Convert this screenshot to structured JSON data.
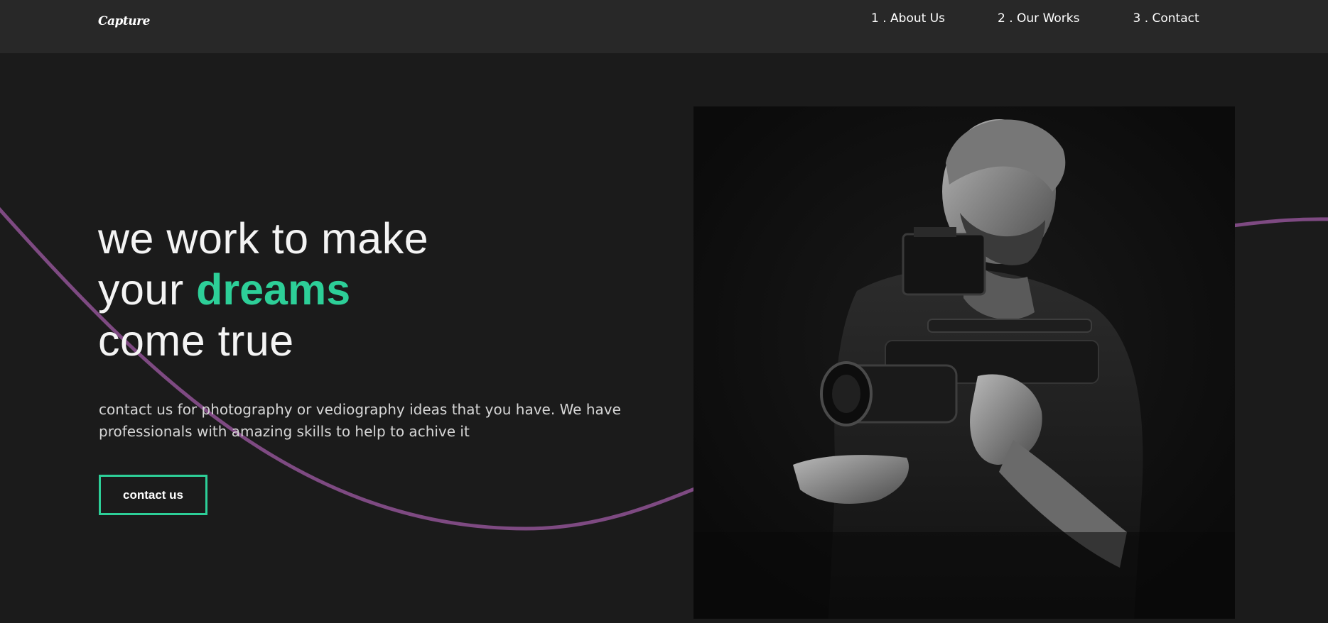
{
  "header": {
    "logo": "Capture",
    "nav": [
      {
        "label": "1 . About Us"
      },
      {
        "label": "2 . Our Works"
      },
      {
        "label": "3 . Contact"
      }
    ]
  },
  "hero": {
    "title_line1": "we work to make",
    "title_line2_prefix": "your ",
    "title_line2_accent": "dreams",
    "title_line3": "come true",
    "description": "contact us for photography or vediography ideas that you have. We have professionals with amazing skills to help to achive it",
    "cta_label": "contact us"
  },
  "image": {
    "icon": "videographer-photo"
  },
  "colors": {
    "background": "#1b1b1b",
    "nav_background": "#282828",
    "accent": "#2dcf98",
    "wave": "#7e4a82"
  }
}
